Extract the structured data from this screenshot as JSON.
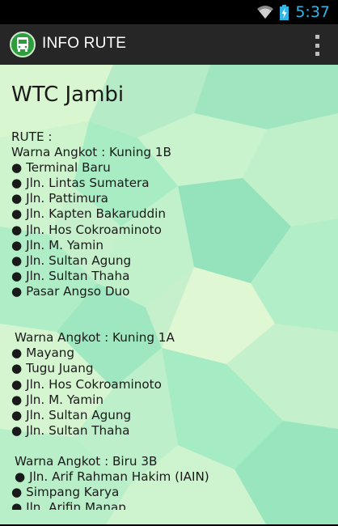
{
  "status_bar": {
    "time": "5:37",
    "wifi_icon": "wifi-icon",
    "battery_icon": "battery-charging-icon"
  },
  "action_bar": {
    "title": "INFO RUTE",
    "app_icon": "bus-icon",
    "menu_icon": "overflow-menu-icon"
  },
  "page": {
    "title": "WTC Jambi",
    "rute_label": "RUTE :",
    "routes": [
      {
        "heading": "Warna Angkot : Kuning 1B",
        "stops": [
          "Terminal Baru",
          "Jln. Lintas Sumatera",
          "Jln. Pattimura",
          "Jln. Kapten Bakaruddin",
          "Jln. Hos Cokroaminoto",
          "Jln. M. Yamin",
          "Jln. Sultan Agung",
          "Jln. Sultan Thaha",
          "Pasar Angso Duo"
        ]
      },
      {
        "heading": "Warna Angkot : Kuning 1A",
        "stops": [
          "Mayang",
          "Tugu Juang",
          "Jln. Hos Cokroaminoto",
          "Jln. M. Yamin",
          "Jln. Sultan Agung",
          "Jln. Sultan Thaha"
        ]
      },
      {
        "heading": "Warna Angkot : Biru 3B",
        "stops": [
          "Jln. Arif Rahman Hakim (IAIN)",
          "Simpang Karya",
          "Jln. Arifin Manap"
        ]
      }
    ]
  },
  "colors": {
    "accent": "#33b5e5",
    "action_bar": "#262626",
    "bg_light": "#d9f5d0",
    "bg_mint": "#a8ecc4"
  }
}
